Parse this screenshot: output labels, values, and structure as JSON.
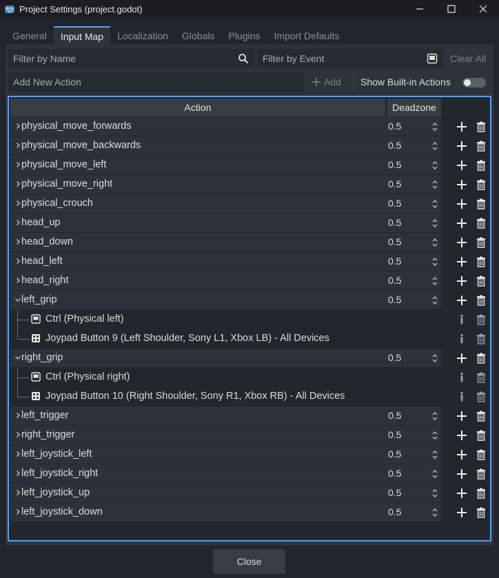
{
  "window": {
    "title": "Project Settings (project.godot)",
    "controls": [
      "minimize-icon",
      "maximize-icon",
      "close-icon"
    ]
  },
  "tabs": [
    {
      "label": "General",
      "active": false
    },
    {
      "label": "Input Map",
      "active": true
    },
    {
      "label": "Localization",
      "active": false
    },
    {
      "label": "Globals",
      "active": false
    },
    {
      "label": "Plugins",
      "active": false
    },
    {
      "label": "Import Defaults",
      "active": false
    }
  ],
  "filters": {
    "by_name_placeholder": "Filter by Name",
    "by_event_placeholder": "Filter by Event",
    "clear_all": "Clear All"
  },
  "add_action": {
    "placeholder": "Add New Action",
    "add_label": "Add",
    "show_builtin_label": "Show Built-in Actions",
    "show_builtin_on": false
  },
  "table": {
    "col_action": "Action",
    "col_deadzone": "Deadzone",
    "rows": [
      {
        "kind": "action",
        "name": "physical_move_forwards",
        "deadzone": "0.5",
        "expanded": false
      },
      {
        "kind": "action",
        "name": "physical_move_backwards",
        "deadzone": "0.5",
        "expanded": false
      },
      {
        "kind": "action",
        "name": "physical_move_left",
        "deadzone": "0.5",
        "expanded": false
      },
      {
        "kind": "action",
        "name": "physical_move_right",
        "deadzone": "0.5",
        "expanded": false
      },
      {
        "kind": "action",
        "name": "physical_crouch",
        "deadzone": "0.5",
        "expanded": false
      },
      {
        "kind": "action",
        "name": "head_up",
        "deadzone": "0.5",
        "expanded": false
      },
      {
        "kind": "action",
        "name": "head_down",
        "deadzone": "0.5",
        "expanded": false
      },
      {
        "kind": "action",
        "name": "head_left",
        "deadzone": "0.5",
        "expanded": false
      },
      {
        "kind": "action",
        "name": "head_right",
        "deadzone": "0.5",
        "expanded": false
      },
      {
        "kind": "action",
        "name": "left_grip",
        "deadzone": "0.5",
        "expanded": true
      },
      {
        "kind": "event",
        "icon": "keyboard-icon",
        "name": "Ctrl (Physical left)",
        "last": false
      },
      {
        "kind": "event",
        "icon": "joypad-icon",
        "name": "Joypad Button 9 (Left Shoulder, Sony L1, Xbox LB) - All Devices",
        "last": true
      },
      {
        "kind": "action",
        "name": "right_grip",
        "deadzone": "0.5",
        "expanded": true
      },
      {
        "kind": "event",
        "icon": "keyboard-icon",
        "name": "Ctrl (Physical right)",
        "last": false
      },
      {
        "kind": "event",
        "icon": "joypad-icon",
        "name": "Joypad Button 10 (Right Shoulder, Sony R1, Xbox RB) - All Devices",
        "last": true
      },
      {
        "kind": "action",
        "name": "left_trigger",
        "deadzone": "0.5",
        "expanded": false
      },
      {
        "kind": "action",
        "name": "right_trigger",
        "deadzone": "0.5",
        "expanded": false
      },
      {
        "kind": "action",
        "name": "left_joystick_left",
        "deadzone": "0.5",
        "expanded": false
      },
      {
        "kind": "action",
        "name": "left_joystick_right",
        "deadzone": "0.5",
        "expanded": false
      },
      {
        "kind": "action",
        "name": "left_joystick_up",
        "deadzone": "0.5",
        "expanded": false
      },
      {
        "kind": "action",
        "name": "left_joystick_down",
        "deadzone": "0.5",
        "expanded": false
      }
    ]
  },
  "footer": {
    "close_label": "Close"
  },
  "colors": {
    "accent": "#5fa0e6",
    "background": "#21252c",
    "panel": "#2e333b",
    "row": "#2d323a"
  }
}
